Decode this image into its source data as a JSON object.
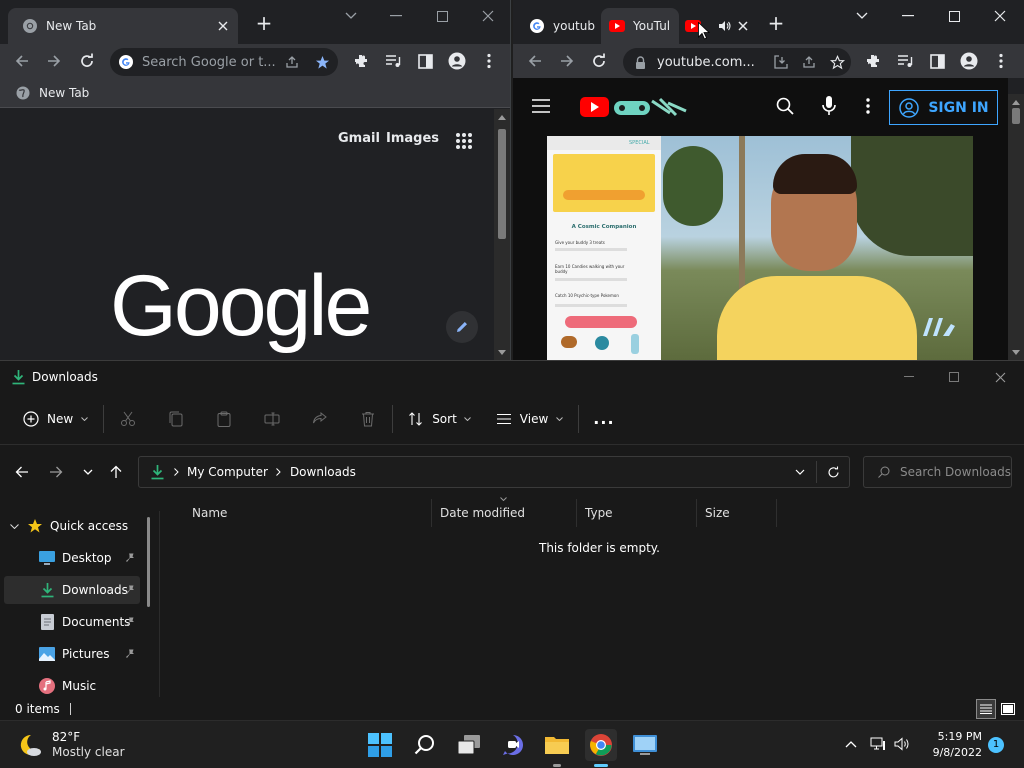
{
  "chrome_left": {
    "tab_title": "New Tab",
    "new_tab_symbol": "+",
    "omnibox_placeholder": "Search Google or t...",
    "bookmark_label": "New Tab",
    "gmail_link": "Gmail",
    "images_link": "Images",
    "logo_text": "Google"
  },
  "chrome_right": {
    "tabs": [
      {
        "title": "youtub"
      },
      {
        "title": "YouTul"
      },
      {
        "title": ""
      }
    ],
    "new_tab_symbol": "+",
    "url": "youtube.com...",
    "sign_in_label": "SIGN IN",
    "video": {
      "app_header": "A Cosmic Companion",
      "tab_label": "SPECIAL",
      "tasks": [
        "Give your buddy 3 treats",
        "Earn 10 Candies walking with your buddy",
        "Catch 10 Psychic-type Pokemon"
      ]
    }
  },
  "explorer": {
    "title": "Downloads",
    "new_label": "New",
    "sort_label": "Sort",
    "view_label": "View",
    "more_label": "...",
    "breadcrumb": [
      "My Computer",
      "Downloads"
    ],
    "search_placeholder": "Search Downloads",
    "sidebar": [
      {
        "label": "Quick access"
      },
      {
        "label": "Desktop"
      },
      {
        "label": "Downloads"
      },
      {
        "label": "Documents"
      },
      {
        "label": "Pictures"
      },
      {
        "label": "Music"
      }
    ],
    "columns": [
      "Name",
      "Date modified",
      "Type",
      "Size"
    ],
    "empty_message": "This folder is empty.",
    "status": "0 items"
  },
  "taskbar": {
    "weather_temp": "82°F",
    "weather_desc": "Mostly clear",
    "time": "5:19 PM",
    "date": "9/8/2022",
    "notification_count": "1"
  },
  "colors": {
    "accent_blue": "#8ab4f8",
    "youtube_red": "#ff0000",
    "download_green": "#2fb57a",
    "star_gold": "#f5c518"
  }
}
